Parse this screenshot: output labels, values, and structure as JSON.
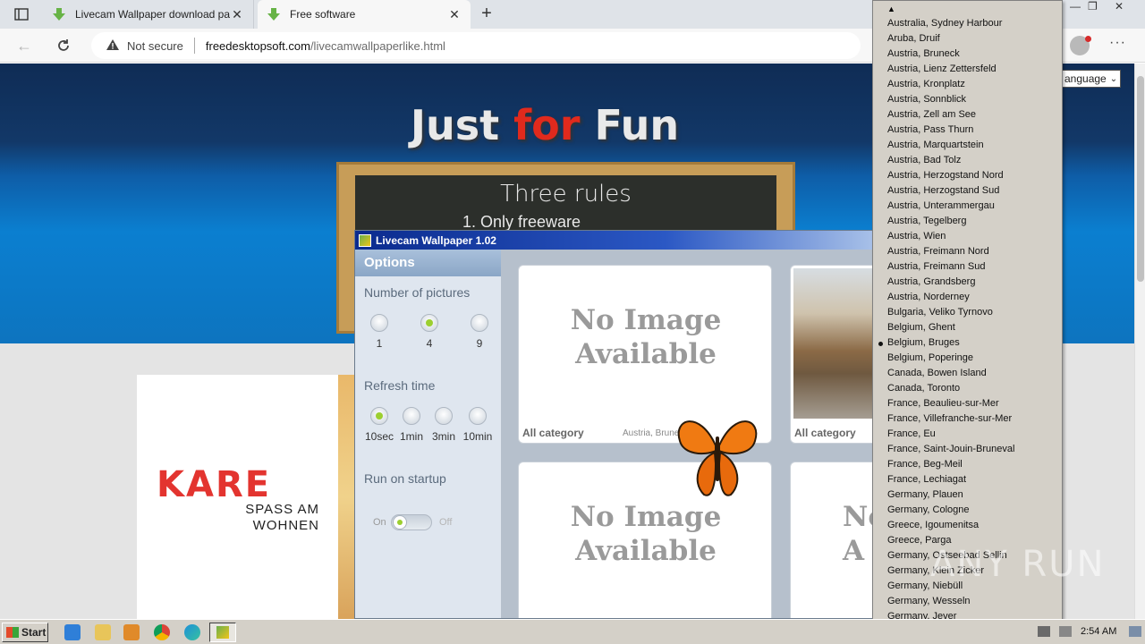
{
  "browser": {
    "tabs": [
      {
        "title": "Livecam Wallpaper download pa",
        "active": false
      },
      {
        "title": "Free software",
        "active": true
      }
    ],
    "address": {
      "security_label": "Not secure",
      "host": "freedesktopsoft.com",
      "path": "/livecamwallpaperlike.html"
    }
  },
  "page": {
    "hero_title_part1": "Just ",
    "hero_title_red": "for",
    "hero_title_part2": " Fun",
    "language_select": "anguage",
    "board_title": "Three rules",
    "board_rule": "1. Only freeware",
    "ad": {
      "logo": "KARE",
      "tagline1": "SPASS AM",
      "tagline2": "WOHNEN"
    }
  },
  "livecam": {
    "title": "Livecam Wallpaper 1.02",
    "options_label": "Options",
    "pictures_label": "Number of pictures",
    "pictures_options": [
      "1",
      "4",
      "9"
    ],
    "pictures_selected": "4",
    "refresh_label": "Refresh time",
    "refresh_options": [
      "10sec",
      "1min",
      "3min",
      "10min"
    ],
    "refresh_selected": "10sec",
    "startup_label": "Run on startup",
    "startup_on": "On",
    "startup_off": "Off",
    "tiles": [
      {
        "text1": "No Image",
        "text2": "Available",
        "category": "All category",
        "location": "Austria, Bruneck"
      },
      {
        "category": "All category"
      },
      {
        "text1": "No Image",
        "text2": "Available"
      },
      {
        "text1": "No",
        "text2": "A"
      }
    ]
  },
  "dropdown": {
    "selected": "Belgium, Bruges",
    "items": [
      "Australia, Sydney Harbour",
      "Aruba, Druif",
      "Austria, Bruneck",
      "Austria, Lienz Zettersfeld",
      "Austria, Kronplatz",
      "Austria, Sonnblick",
      "Austria, Zell am See",
      "Austria, Pass Thurn",
      "Austria, Marquartstein",
      "Austria, Bad Tolz",
      "Austria, Herzogstand Nord",
      "Austria, Herzogstand Sud",
      "Austria, Unterammergau",
      "Austria, Tegelberg",
      "Austria, Wien",
      "Austria, Freimann Nord",
      "Austria, Freimann Sud",
      "Austria, Grandsberg",
      "Austria, Norderney",
      "Bulgaria, Veliko Tyrnovo",
      "Belgium, Ghent",
      "Belgium, Bruges",
      "Belgium, Poperinge",
      "Canada, Bowen Island",
      "Canada, Toronto",
      "France, Beaulieu-sur-Mer",
      "France, Villefranche-sur-Mer",
      "France, Eu",
      "France, Saint-Jouin-Bruneval",
      "France, Beg-Meil",
      "France, Lechiagat",
      "Germany, Plauen",
      "Germany, Cologne",
      "Greece, Igoumenitsa",
      "Greece, Parga",
      "Germany, Ostseebad Sellin",
      "Germany, Klein Zicker",
      "Germany, Niebüll",
      "Germany, Wesseln",
      "Germany, Jever"
    ]
  },
  "watermark": "ANY RUN",
  "taskbar": {
    "start_label": "Start",
    "time": "2:54 AM"
  },
  "colors": {
    "accent_red": "#e02a1d",
    "titlebar_blue": "#0b2b8e",
    "radio_green": "#9ccf2f"
  }
}
